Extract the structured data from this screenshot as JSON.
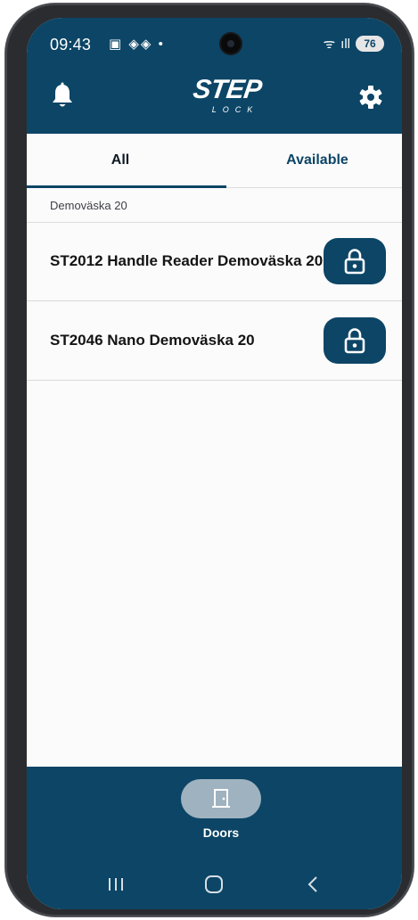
{
  "status": {
    "time": "09:43",
    "left_icons": "▣ ◈◈ •",
    "wifi": "ᯤ",
    "signal": "ıll",
    "battery": "76"
  },
  "header": {
    "logo_main": "STEP",
    "logo_sub": "LOCK",
    "icons": [
      "bell-icon",
      "gear-icon"
    ]
  },
  "tabs": [
    {
      "label": "All",
      "selected": true
    },
    {
      "label": "Available",
      "selected": false
    }
  ],
  "sections": [
    {
      "title": "Demoväska 20",
      "doors": [
        {
          "name": "ST2012 Handle Reader Demoväska 20"
        },
        {
          "name": "ST2046 Nano Demoväska 20"
        }
      ]
    }
  ],
  "bottom_nav": {
    "items": [
      {
        "label": "Doors",
        "icon": "door-icon",
        "selected": true
      }
    ]
  },
  "colors": {
    "primary": "#0c4566",
    "nav_pill": "#9fb2c0",
    "background": "#fcfbfc"
  }
}
